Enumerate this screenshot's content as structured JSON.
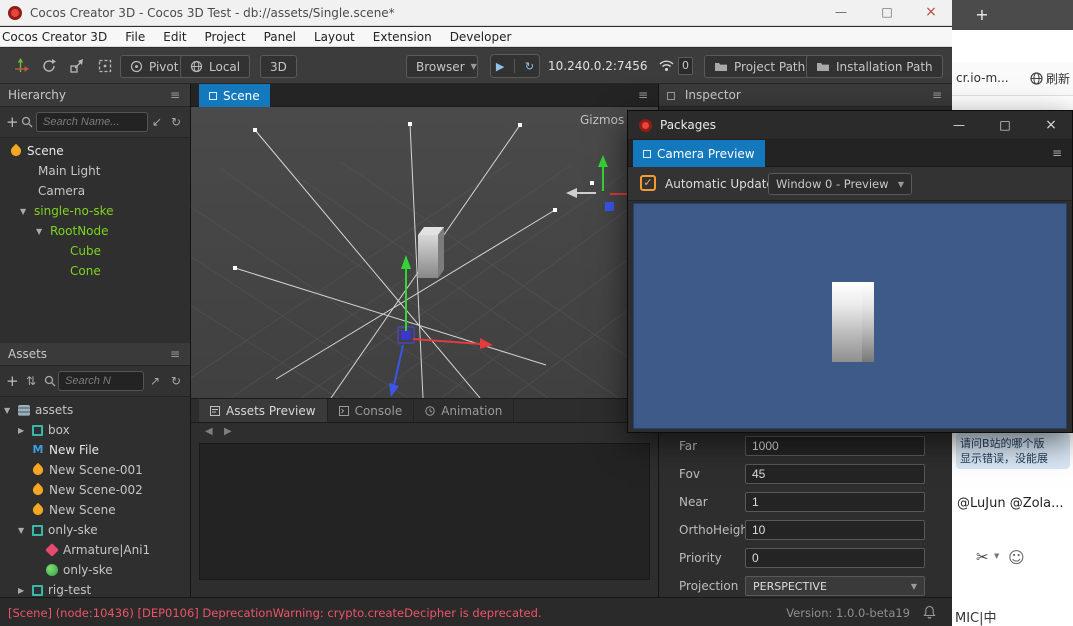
{
  "colors": {
    "accent_blue": "#1478bd",
    "selected_green": "#7ed321",
    "warning_red": "#ee5368",
    "checkbox_orange": "#f59a33",
    "preview_blue": "#3d5a88"
  },
  "icons": {
    "hamburger": "≡",
    "caret_down": "▼",
    "play": "▶",
    "step": "↻",
    "prev_arrow": "◀",
    "next_arrow": "▶",
    "plus": "+",
    "refresh": "↻",
    "collapse_all": "↙",
    "expand_all": "↗",
    "sort": "⇅",
    "check": "✓",
    "scissors": "✂",
    "smiley": "☺"
  },
  "titlebar": {
    "title": "Cocos Creator 3D - Cocos 3D Test - db://assets/Single.scene*",
    "minimize": "—",
    "maximize": "□",
    "close": "×"
  },
  "menubar": {
    "items": [
      "Cocos Creator 3D",
      "File",
      "Edit",
      "Project",
      "Panel",
      "Layout",
      "Extension",
      "Developer"
    ]
  },
  "toolbar": {
    "pivot_label": "Pivot",
    "local_label": "Local",
    "mode_3d": "3D",
    "browser_label": "Browser",
    "address": "10.240.0.2:7456",
    "connection_count": "0",
    "project_path_label": "Project Path",
    "installation_path_label": "Installation Path"
  },
  "hierarchy": {
    "title": "Hierarchy",
    "search_placeholder": "Search Name...",
    "items": [
      {
        "label": "Scene",
        "expander": ""
      },
      {
        "label": "Main Light",
        "expander": ""
      },
      {
        "label": "Camera",
        "expander": ""
      },
      {
        "label": "single-no-ske",
        "expander": "▼"
      },
      {
        "label": "RootNode",
        "expander": "▼"
      },
      {
        "label": "Cube",
        "expander": ""
      },
      {
        "label": "Cone",
        "expander": ""
      }
    ]
  },
  "assets_panel": {
    "title": "Assets",
    "search_placeholder": "Search N",
    "items": [
      {
        "label": "assets",
        "expander": "▼"
      },
      {
        "label": "box",
        "expander": "▶"
      },
      {
        "label": "New File",
        "expander": ""
      },
      {
        "label": "New Scene-001",
        "expander": ""
      },
      {
        "label": "New Scene-002",
        "expander": ""
      },
      {
        "label": "New Scene",
        "expander": ""
      },
      {
        "label": "only-ske",
        "expander": "▼"
      },
      {
        "label": "Armature|Ani1",
        "expander": ""
      },
      {
        "label": "only-ske",
        "expander": ""
      },
      {
        "label": "rig-test",
        "expander": "▶"
      }
    ]
  },
  "scene_view": {
    "tab_label": "Scene",
    "gizmos_label": "Gizmos"
  },
  "bottom_tabs": {
    "assets_preview": "Assets Preview",
    "console": "Console",
    "animation": "Animation"
  },
  "inspector": {
    "title": "Inspector",
    "fields": [
      {
        "label": "Far",
        "value": "1000"
      },
      {
        "label": "Fov",
        "value": "45"
      },
      {
        "label": "Near",
        "value": "1"
      },
      {
        "label": "OrthoHeight",
        "value": "10"
      },
      {
        "label": "Priority",
        "value": "0"
      },
      {
        "label": "Projection",
        "value": "PERSPECTIVE"
      }
    ]
  },
  "packages_window": {
    "title": "Packages",
    "tab_label": "Camera Preview",
    "auto_updates_label": "Automatic Updates",
    "window_select_value": "Window 0 - Preview",
    "minimize": "—",
    "maximize": "□",
    "close": "×"
  },
  "statusbar": {
    "warning": "[Scene] (node:10436) [DEP0106] DeprecationWarning: crypto.createDecipher is deprecated.",
    "version": "Version: 1.0.0-beta19"
  },
  "side_window": {
    "new_tab": "+",
    "url_text": "cr.io-m...",
    "refresh_label": "刷新",
    "message_line1": "请问B站的哪个版",
    "message_line2": "显示错误，没能展",
    "mentions": "@LuJun @Zola...",
    "bottom_partial": "MIC|中"
  }
}
